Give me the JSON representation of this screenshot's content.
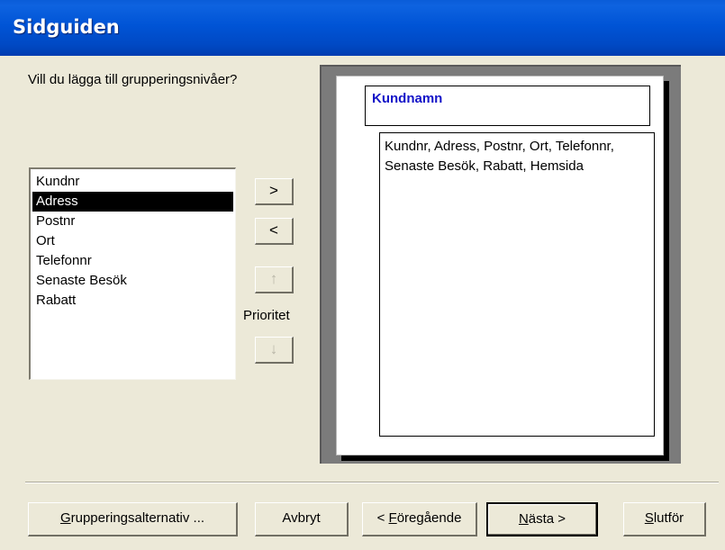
{
  "window": {
    "title": "Sidguiden"
  },
  "question": "Vill du lägga till grupperingsnivåer?",
  "field_list": {
    "items": [
      "Kundnr",
      "Adress",
      "Postnr",
      "Ort",
      "Telefonnr",
      "Senaste Besök",
      "Rabatt"
    ],
    "selected": "Adress"
  },
  "side_buttons": {
    "add": ">",
    "remove": "<",
    "priority_up": "↑",
    "priority_down": "↓",
    "priority_label": "Prioritet"
  },
  "preview": {
    "group_field": "Kundnamn",
    "detail_fields": "Kundnr, Adress, Postnr, Ort, Telefonnr, Senaste Besök, Rabatt, Hemsida"
  },
  "buttons": {
    "grouping_options": {
      "accel": "G",
      "rest": "rupperingsalternativ ..."
    },
    "cancel": "Avbryt",
    "back": {
      "pre": "< ",
      "accel": "F",
      "rest": "öregående"
    },
    "next": {
      "accel": "N",
      "rest": "ästa >"
    },
    "finish": {
      "accel": "S",
      "rest": "lutför"
    }
  }
}
